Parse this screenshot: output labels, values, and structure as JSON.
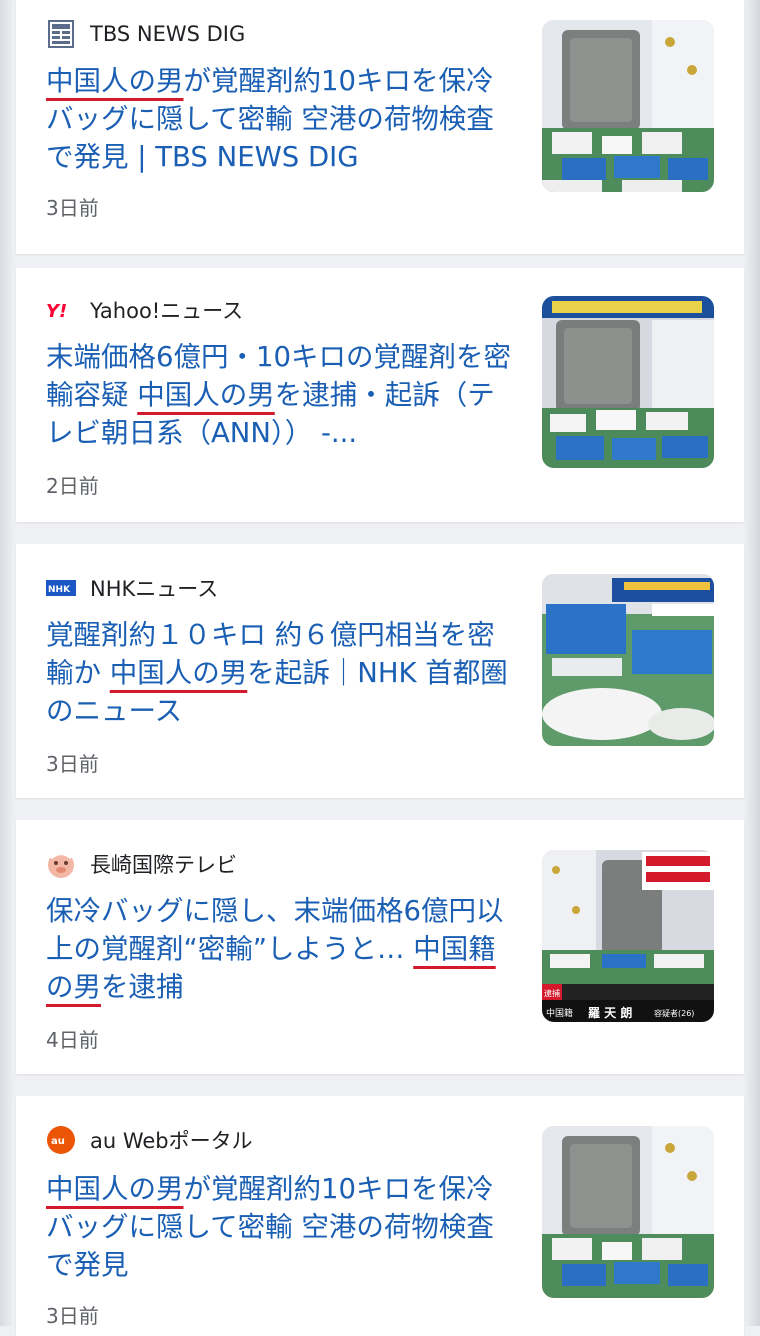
{
  "colors": {
    "headline": "#1a5fb4",
    "highlight_underline": "#d4192c",
    "meta_text": "#5f6368",
    "background": "#eef0f3"
  },
  "articles": [
    {
      "source": "TBS NEWS DIG",
      "source_icon": "tbs-news-dig-icon",
      "title_pre": "",
      "title_hl": "中国人の男",
      "title_mid": "が覚醒剤約10キロを保冷バッグに隠して密輸 空港の荷物検査で発見 | TBS NEWS DIG",
      "title_hl2": "",
      "title_post": "",
      "age": "3日前"
    },
    {
      "source": "Yahoo!ニュース",
      "source_icon": "yahoo-icon",
      "title_pre": "末端価格6億円・10キロの覚醒剤を密輸容疑 ",
      "title_hl": "中国人の男",
      "title_mid": "を逮捕・起訴（テレビ朝日系（ANN）） -...",
      "title_hl2": "",
      "title_post": "",
      "age": "2日前"
    },
    {
      "source": "NHKニュース",
      "source_icon": "nhk-icon",
      "title_pre": "覚醒剤約１０キロ 約６億円相当を密輸か ",
      "title_hl": "中国人の男",
      "title_mid": "を起訴｜NHK 首都圏のニュース",
      "title_hl2": "",
      "title_post": "",
      "age": "3日前"
    },
    {
      "source": "長崎国際テレビ",
      "source_icon": "nagasaki-tv-icon",
      "title_pre": "保冷バッグに隠し、末端価格6億円以上の覚醒剤“密輸”しようと… ",
      "title_hl": "",
      "title_mid": "",
      "title_hl2": "中国籍の男",
      "title_post": "を逮捕",
      "age": "4日前"
    },
    {
      "source": "au Webポータル",
      "source_icon": "au-web-portal-icon",
      "title_pre": "",
      "title_hl": "中国人の男",
      "title_mid": "が覚醒剤約10キロを保冷バッグに隠して密輸 空港の荷物検査で発見",
      "title_hl2": "",
      "title_post": "",
      "age": "3日前"
    }
  ],
  "thumbnails": {
    "tv_caption_prefix": "逮捕",
    "tv_caption_country": "中国籍",
    "tv_caption_name": "羅 天 朗",
    "tv_caption_suffix": "容疑者(26)"
  }
}
